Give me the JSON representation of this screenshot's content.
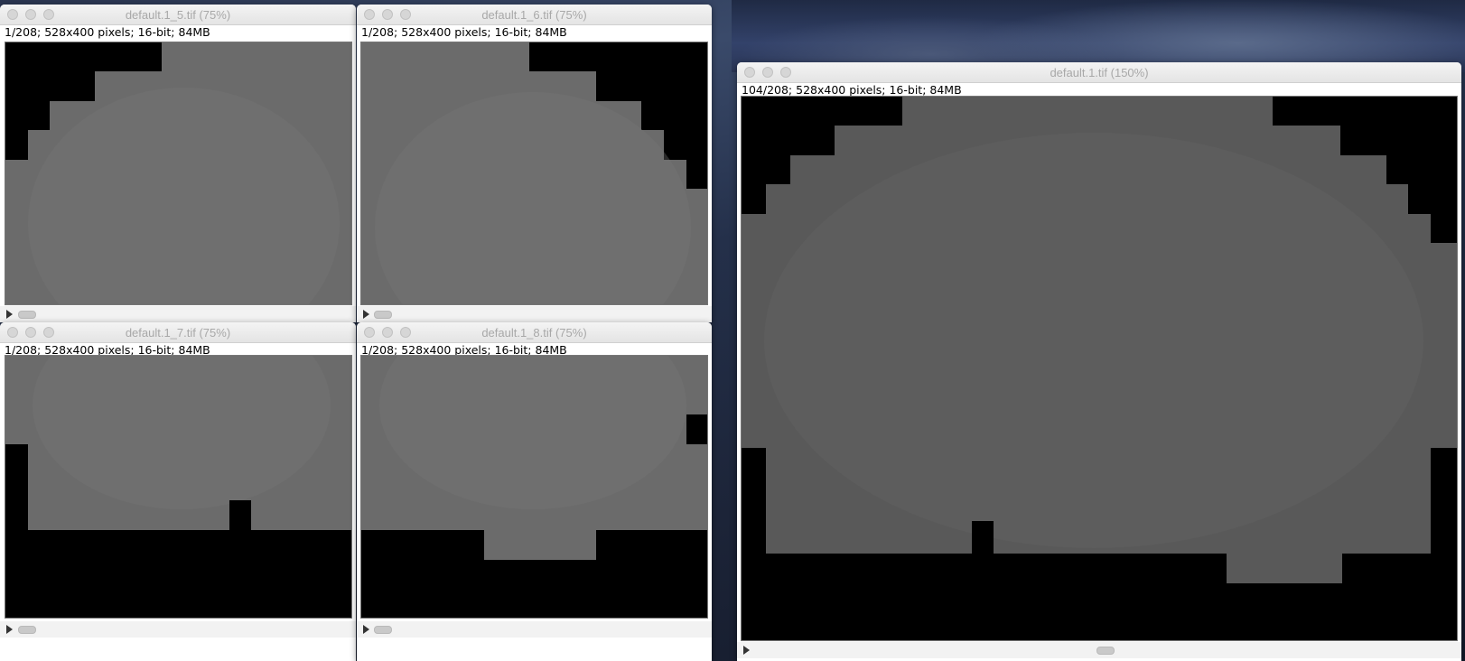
{
  "windows": [
    {
      "title": "default.1_5.tif (75%)",
      "info": "1/208; 528x400 pixels; 16-bit; 84MB"
    },
    {
      "title": "default.1_6.tif (75%)",
      "info": "1/208; 528x400 pixels; 16-bit; 84MB"
    },
    {
      "title": "default.1_7.tif (75%)",
      "info": "1/208; 528x400 pixels; 16-bit; 84MB"
    },
    {
      "title": "default.1_8.tif (75%)",
      "info": "1/208; 528x400 pixels; 16-bit; 84MB"
    },
    {
      "title": "default.1.tif (150%)",
      "info": "104/208; 528x400 pixels; 16-bit; 84MB"
    }
  ],
  "icons": {
    "window_controls": [
      "close-icon",
      "minimize-icon",
      "zoom-icon"
    ],
    "play": "play-icon"
  },
  "colors": {
    "image_background": "#000000",
    "tissue_gray": "#6b6b6b",
    "title_text": "#a8a8a8"
  }
}
